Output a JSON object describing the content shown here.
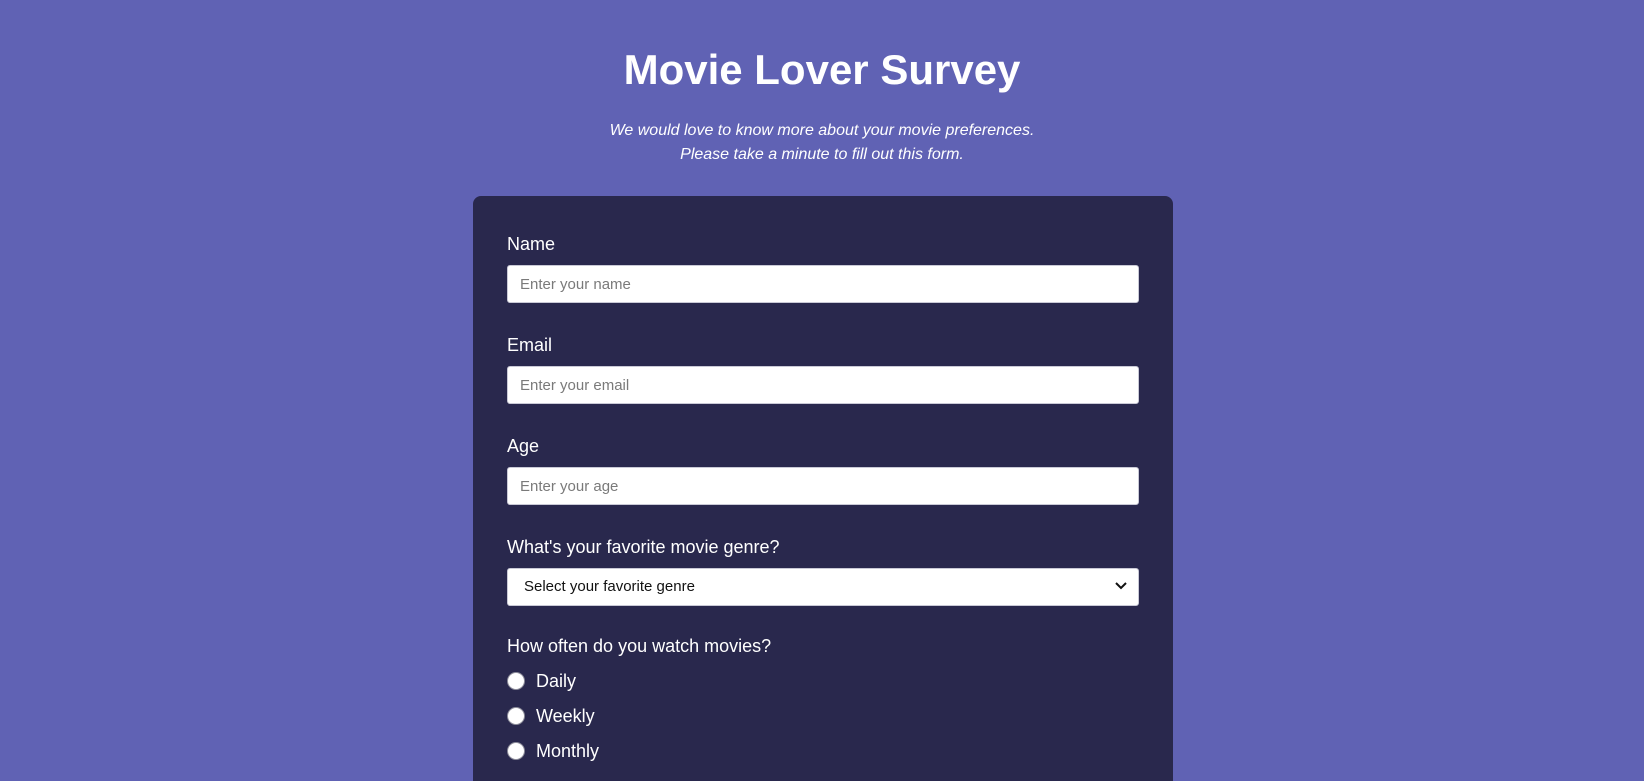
{
  "header": {
    "title": "Movie Lover Survey",
    "subtitle_line1": "We would love to know more about your movie preferences.",
    "subtitle_line2": "Please take a minute to fill out this form."
  },
  "form": {
    "name": {
      "label": "Name",
      "placeholder": "Enter your name",
      "value": ""
    },
    "email": {
      "label": "Email",
      "placeholder": "Enter your email",
      "value": ""
    },
    "age": {
      "label": "Age",
      "placeholder": "Enter your age",
      "value": ""
    },
    "genre": {
      "label": "What's your favorite movie genre?",
      "selected": "Select your favorite genre"
    },
    "frequency": {
      "label": "How often do you watch movies?",
      "options": [
        "Daily",
        "Weekly",
        "Monthly"
      ]
    }
  },
  "colors": {
    "background": "#6062b4",
    "card": "#29284d",
    "text": "#ffffff"
  },
  "icons": {
    "select_arrow": "chevron-down-icon"
  }
}
